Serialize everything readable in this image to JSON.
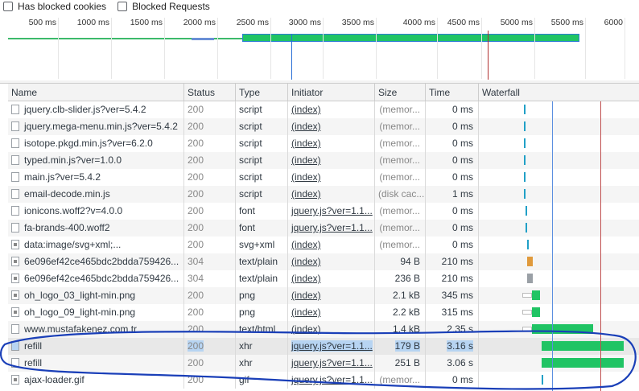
{
  "filters": {
    "blocked_cookies": "Has blocked cookies",
    "blocked_requests": "Blocked Requests"
  },
  "timeline": {
    "ticks": [
      "500 ms",
      "1000 ms",
      "1500 ms",
      "2000 ms",
      "2500 ms",
      "3000 ms",
      "3500 ms",
      "4000 ms",
      "4500 ms",
      "5000 ms",
      "5500 ms",
      "6000"
    ]
  },
  "columns": {
    "name": "Name",
    "status": "Status",
    "type": "Type",
    "initiator": "Initiator",
    "size": "Size",
    "time": "Time",
    "waterfall": "Waterfall"
  },
  "rows": [
    {
      "name": "jquery.clb-slider.js?ver=5.4.2",
      "status": "200",
      "type": "script",
      "initiator": "(index)",
      "size": "(memor...",
      "time": "0 ms"
    },
    {
      "name": "jquery.mega-menu.min.js?ver=5.4.2",
      "status": "200",
      "type": "script",
      "initiator": "(index)",
      "size": "(memor...",
      "time": "0 ms"
    },
    {
      "name": "isotope.pkgd.min.js?ver=6.2.0",
      "status": "200",
      "type": "script",
      "initiator": "(index)",
      "size": "(memor...",
      "time": "0 ms"
    },
    {
      "name": "typed.min.js?ver=1.0.0",
      "status": "200",
      "type": "script",
      "initiator": "(index)",
      "size": "(memor...",
      "time": "0 ms"
    },
    {
      "name": "main.js?ver=5.4.2",
      "status": "200",
      "type": "script",
      "initiator": "(index)",
      "size": "(memor...",
      "time": "0 ms"
    },
    {
      "name": "email-decode.min.js",
      "status": "200",
      "type": "script",
      "initiator": "(index)",
      "size": "(disk cac...",
      "time": "1 ms"
    },
    {
      "name": "ionicons.woff2?v=4.0.0",
      "status": "200",
      "type": "font",
      "initiator": "jquery.js?ver=1.1...",
      "size": "(memor...",
      "time": "0 ms"
    },
    {
      "name": "fa-brands-400.woff2",
      "status": "200",
      "type": "font",
      "initiator": "jquery.js?ver=1.1...",
      "size": "(memor...",
      "time": "0 ms"
    },
    {
      "name": "data:image/svg+xml;...",
      "status": "200",
      "type": "svg+xml",
      "initiator": "(index)",
      "size": "(memor...",
      "time": "0 ms"
    },
    {
      "name": "6e096ef42ce465bdc2bdda759426...",
      "status": "304",
      "type": "text/plain",
      "initiator": "(index)",
      "size": "94 B",
      "time": "210 ms"
    },
    {
      "name": "6e096ef42ce465bdc2bdda759426...",
      "status": "304",
      "type": "text/plain",
      "initiator": "(index)",
      "size": "236 B",
      "time": "210 ms"
    },
    {
      "name": "oh_logo_03_light-min.png",
      "status": "200",
      "type": "png",
      "initiator": "(index)",
      "size": "2.1 kB",
      "time": "345 ms"
    },
    {
      "name": "oh_logo_09_light-min.png",
      "status": "200",
      "type": "png",
      "initiator": "(index)",
      "size": "2.2 kB",
      "time": "315 ms"
    },
    {
      "name": "www.mustafakenez.com.tr",
      "status": "200",
      "type": "text/html",
      "initiator": "(index)",
      "size": "1.4 kB",
      "time": "2.35 s"
    },
    {
      "name": "refill",
      "status": "200",
      "type": "xhr",
      "initiator": "jquery.js?ver=1.1...",
      "size": "179 B",
      "time": "3.16 s"
    },
    {
      "name": "refill",
      "status": "200",
      "type": "xhr",
      "initiator": "jquery.js?ver=1.1...",
      "size": "251 B",
      "time": "3.06 s"
    },
    {
      "name": "ajax-loader.gif",
      "status": "200",
      "type": "gif",
      "initiator": "jquery.js?ver=1.1...",
      "size": "(memor...",
      "time": "0 ms"
    }
  ],
  "colors": {
    "bar_green": "#20c464",
    "dom_line": "#2a6fd6",
    "load_line": "#b03030",
    "annotation": "#1a3fb8"
  }
}
